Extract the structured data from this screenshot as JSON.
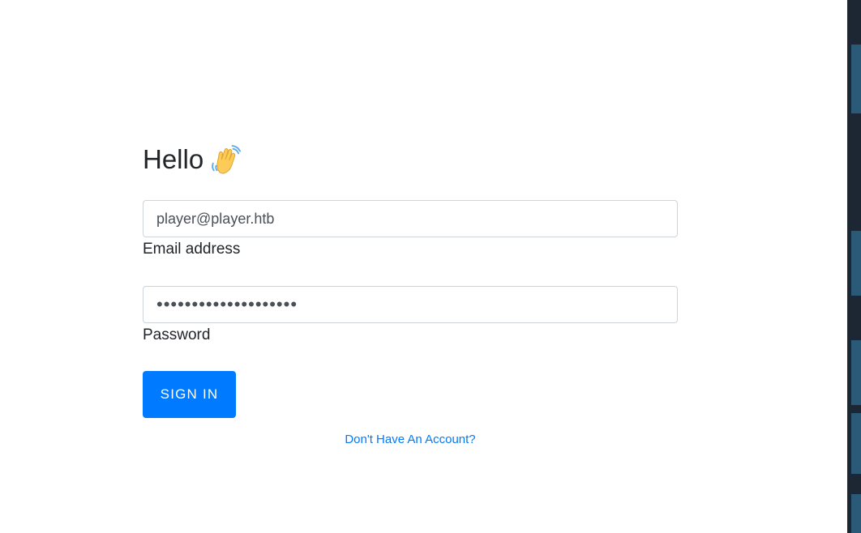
{
  "login": {
    "greeting": "Hello",
    "wave_icon": "waving-hand-icon",
    "email": {
      "value": "player@player.htb",
      "label": "Email address"
    },
    "password": {
      "value": "••••••••••••••••••••",
      "label": "Password"
    },
    "signin_label": "SIGN IN",
    "register_link": "Don't Have An Account?"
  },
  "colors": {
    "accent": "#007bff",
    "border": "#ced4da",
    "text": "#212529",
    "background_strip": "#1c2733"
  }
}
